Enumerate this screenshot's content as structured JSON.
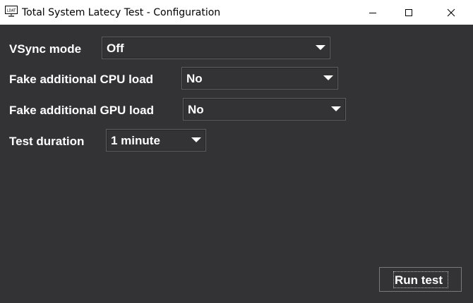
{
  "window": {
    "title": "Total System Latecy Test - Configuration",
    "icon_text": "LDAT",
    "controls": {
      "minimize_icon": "minimize-icon",
      "maximize_icon": "maximize-icon",
      "close_icon": "close-icon"
    }
  },
  "form": {
    "vsync": {
      "label": "VSync mode",
      "value": "Off"
    },
    "cpu_load": {
      "label": "Fake additional CPU load",
      "value": "No"
    },
    "gpu_load": {
      "label": "Fake additional GPU load",
      "value": "No"
    },
    "duration": {
      "label": "Test duration",
      "value": "1 minute"
    }
  },
  "actions": {
    "run_label": "Run test"
  },
  "colors": {
    "background": "#333336",
    "titlebar": "#ffffff",
    "text": "#ffffff"
  }
}
